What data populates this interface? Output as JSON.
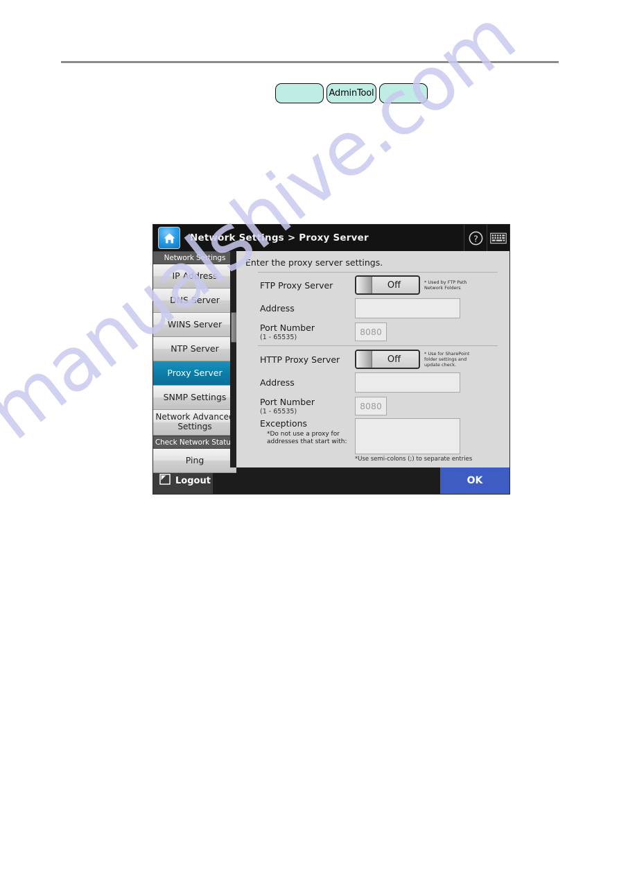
{
  "pills": [
    {
      "label": "",
      "name": "pill-blank-left"
    },
    {
      "label": "AdminTool",
      "name": "pill-admintool"
    },
    {
      "label": "",
      "name": "pill-blank-right"
    }
  ],
  "device": {
    "header": {
      "title": "Network Settings > Proxy Server",
      "home_icon": "home-icon",
      "help_icon": "help-icon",
      "keyboard_icon": "keyboard-icon"
    },
    "sidebar": {
      "groups": [
        {
          "section": "Network Settings",
          "items": [
            {
              "label": "IP Address",
              "selected": false
            },
            {
              "label": "DNS Server",
              "selected": false
            },
            {
              "label": "WINS Server",
              "selected": false
            },
            {
              "label": "NTP Server",
              "selected": false
            },
            {
              "label": "Proxy Server",
              "selected": true
            },
            {
              "label": "SNMP Settings",
              "selected": false
            },
            {
              "label": "Network Advanced Settings",
              "selected": false
            }
          ]
        },
        {
          "section": "Check Network Status",
          "items": [
            {
              "label": "Ping",
              "selected": false
            }
          ]
        }
      ]
    },
    "content": {
      "intro": "Enter the proxy server settings.",
      "ftp": {
        "toggle_label": "FTP Proxy Server",
        "toggle_value": "Off",
        "toggle_note": "* Used by FTP Path Network Folders",
        "address_label": "Address",
        "address_value": "",
        "port_label": "Port Number",
        "port_range": "(1 - 65535)",
        "port_placeholder": "8080"
      },
      "http": {
        "toggle_label": "HTTP Proxy Server",
        "toggle_value": "Off",
        "toggle_note": "* Use for SharePoint folder settings and update check.",
        "address_label": "Address",
        "address_value": "",
        "port_label": "Port Number",
        "port_range": "(1 - 65535)",
        "port_placeholder": "8080",
        "exceptions_label": "Exceptions",
        "exceptions_note": "*Do not use a proxy for addresses that start with:",
        "exceptions_value": "",
        "exceptions_footnote": "*Use semi-colons (;) to separate entries"
      }
    },
    "footer": {
      "logout_label": "Logout",
      "logout_icon": "logout-icon",
      "ok_label": "OK"
    }
  },
  "watermark": "manualshive.com",
  "colors": {
    "selected_item": "#0c7ba8",
    "ok_button": "#3d5dc4",
    "pill_fill": "#bfece5",
    "header_bar": "#131313"
  }
}
